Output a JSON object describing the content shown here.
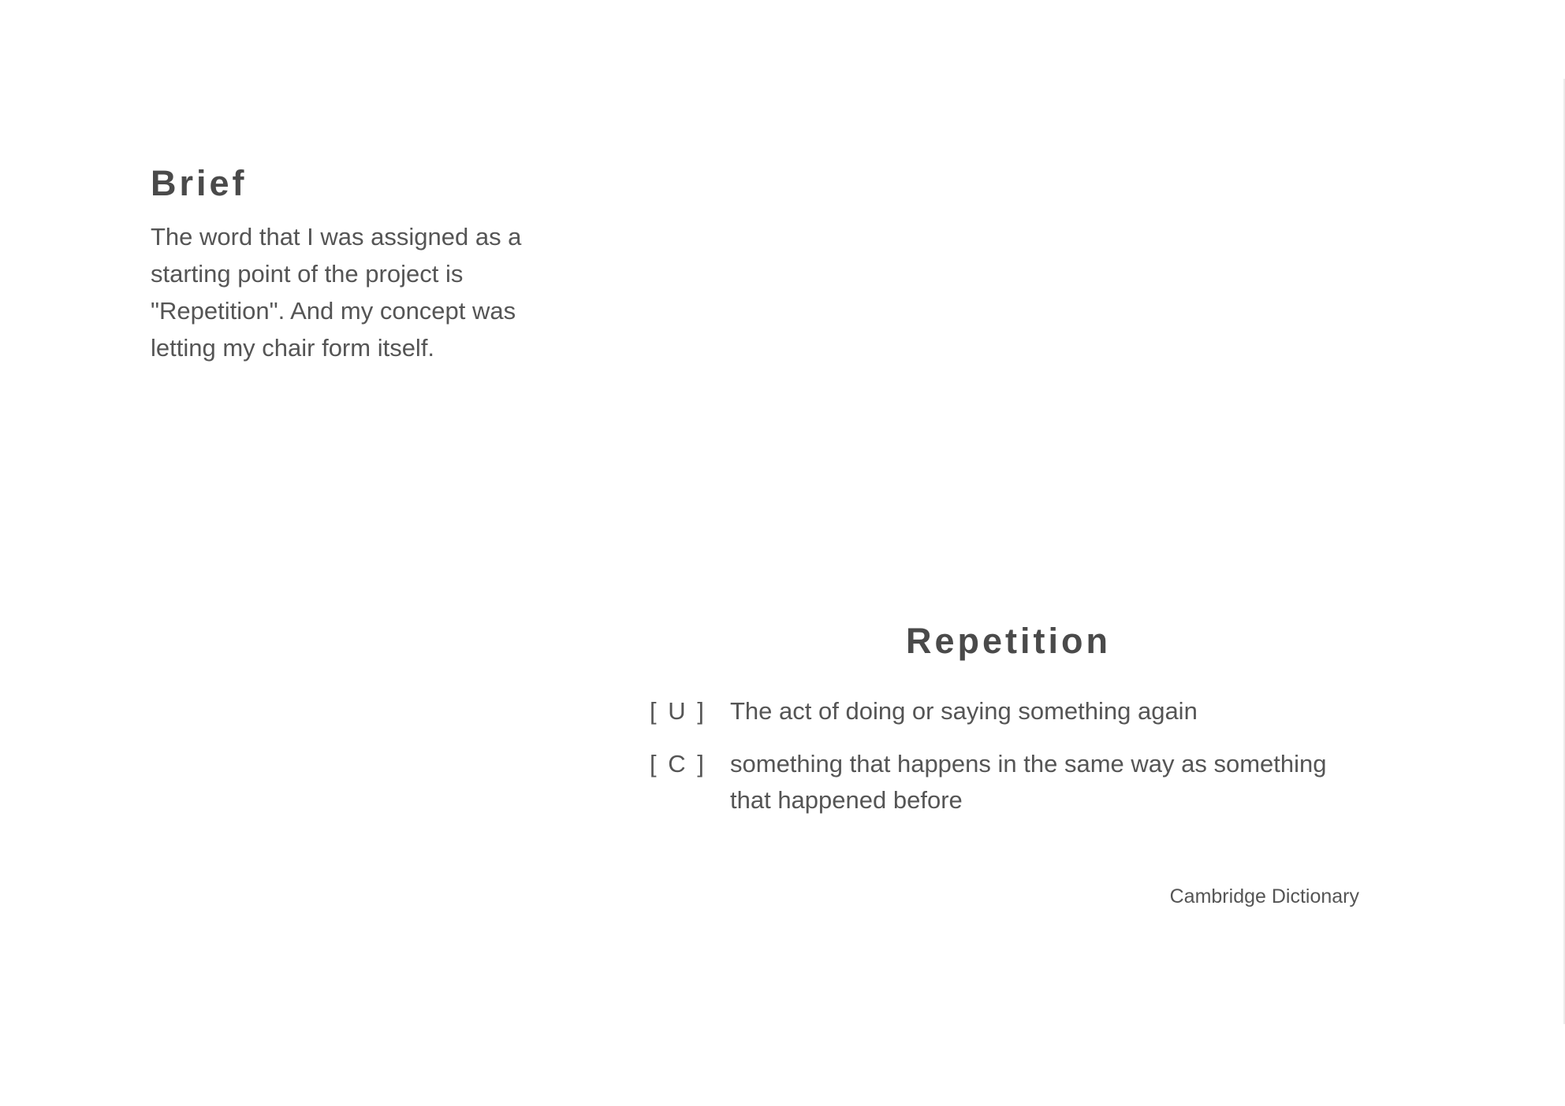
{
  "brief": {
    "title": "Brief",
    "text": "The word that I was assigned as a starting point of the project is \"Repetition\". And my concept was letting my chair form itself."
  },
  "definition": {
    "title": "Repetition",
    "senses": [
      {
        "label": "[ U ]",
        "text": "The act of doing or saying something again"
      },
      {
        "label": "[ C ]",
        "text": "something that happens in the same way as something that happened before"
      }
    ],
    "source": "Cambridge Dictionary"
  }
}
